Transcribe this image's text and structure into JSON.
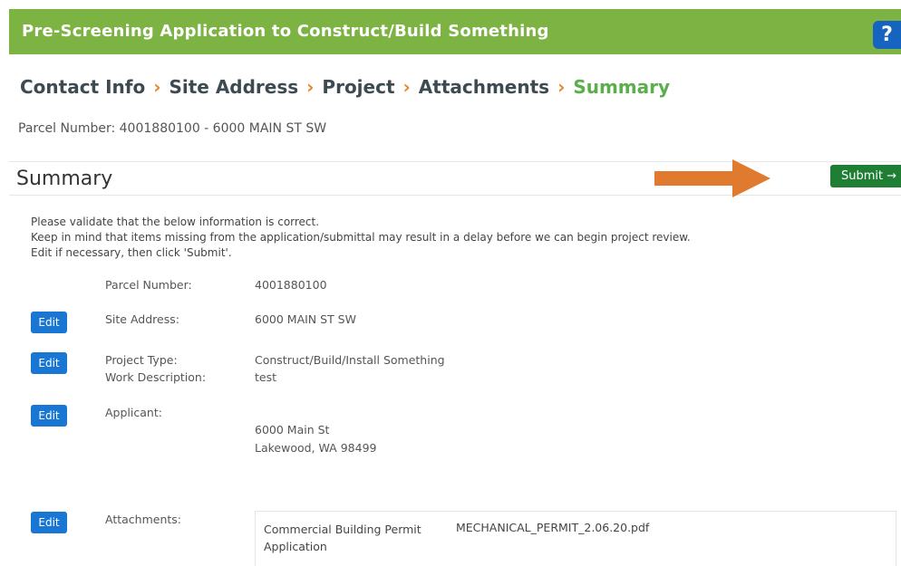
{
  "header": {
    "title": "Pre-Screening Application to Construct/Build Something",
    "help_symbol": "?"
  },
  "breadcrumb": {
    "separator": "›",
    "steps": [
      "Contact Info",
      "Site Address",
      "Project",
      "Attachments",
      "Summary"
    ]
  },
  "parcel_line": "Parcel Number: 4001880100 - 6000 MAIN ST SW",
  "summary": {
    "title": "Summary",
    "submit_label": "Submit →",
    "intro_lines": [
      "Please validate that the below information is correct.",
      "Keep in mind that items missing from the application/submittal may result in a delay before we can begin project review.",
      "Edit if necessary, then click 'Submit'."
    ],
    "edit_label": "Edit",
    "fields": {
      "parcel_label": "Parcel Number:",
      "parcel_value": "4001880100",
      "site_label": "Site Address:",
      "site_value": "6000 MAIN ST SW",
      "project_type_label": "Project Type:",
      "project_type_value": "Construct/Build/Install Something",
      "work_desc_label": "Work Description:",
      "work_desc_value": "test",
      "applicant_label": "Applicant:",
      "applicant_line1": "6000 Main St",
      "applicant_line2": "Lakewood, WA 98499",
      "attachments_label": "Attachments:"
    },
    "attachments": [
      {
        "name_line1": "Commercial Building Permit",
        "name_line2": "Application",
        "file": "MECHANICAL_PERMIT_2.06.20.pdf"
      }
    ]
  },
  "colors": {
    "header": "#7cb342",
    "accent_green": "#5cae4b",
    "separator": "#e0892a",
    "edit_blue": "#1976d2",
    "submit_green": "#1e7e34",
    "arrow": "#e07a2e"
  }
}
